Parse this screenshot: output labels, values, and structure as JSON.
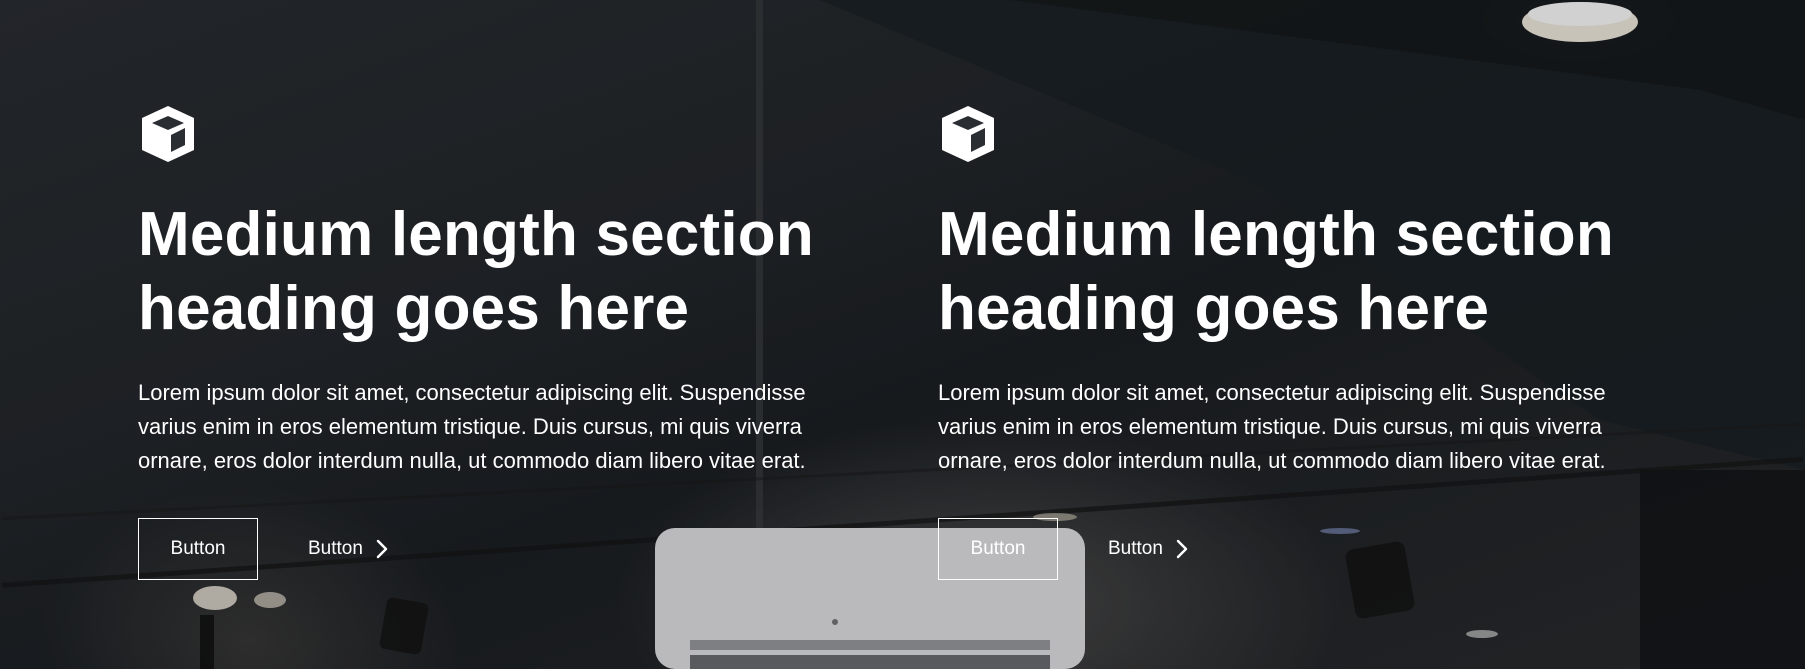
{
  "sections": [
    {
      "icon": "cube-icon",
      "heading": "Medium length section heading goes here",
      "body": "Lorem ipsum dolor sit amet, consectetur adipiscing elit. Suspendisse varius enim in eros elementum tristique. Duis cursus, mi quis viverra ornare, eros dolor interdum nulla, ut commodo diam libero vitae erat.",
      "primary_button_label": "Button",
      "secondary_button_label": "Button",
      "secondary_button_icon": "chevron-right-icon"
    },
    {
      "icon": "cube-icon",
      "heading": "Medium length section heading goes here",
      "body": "Lorem ipsum dolor sit amet, consectetur adipiscing elit. Suspendisse varius enim in eros elementum tristique. Duis cursus, mi quis viverra ornare, eros dolor interdum nulla, ut commodo diam libero vitae erat.",
      "primary_button_label": "Button",
      "secondary_button_label": "Button",
      "secondary_button_icon": "chevron-right-icon"
    }
  ],
  "colors": {
    "text": "#ffffff",
    "button_border": "#ffffff"
  }
}
